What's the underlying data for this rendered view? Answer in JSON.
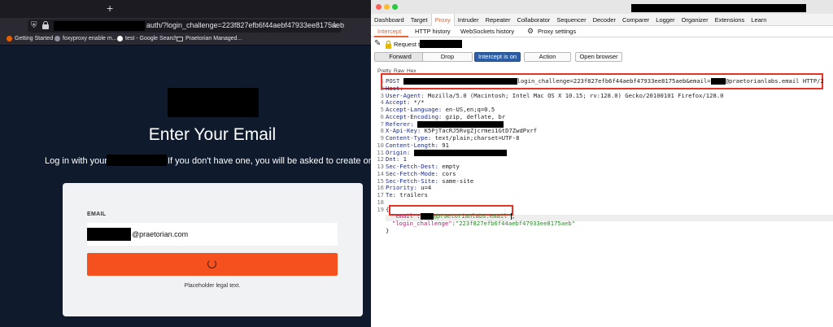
{
  "browser": {
    "new_tab_symbol": "+",
    "url_suffix": "auth/?login_challenge=223f827efb6f44aebf47933ee8175aeb",
    "bookmarks": [
      {
        "label": "Getting Started",
        "color": "#e66000"
      },
      {
        "label": "foxyproxy enable m...",
        "color": "#8f8fa0"
      },
      {
        "label": "test - Google Search",
        "color": "#ffffff"
      },
      {
        "label": "Praetorian Managed...",
        "color": "#c8c8c8"
      }
    ],
    "page": {
      "title": "Enter Your Email",
      "prompt_start": "Log in with your",
      "prompt_end": "If you don't have one, you will be asked to create one.",
      "email_label": "EMAIL",
      "email_domain": "@praetorian.com",
      "legal_text": "Placeholder legal text.",
      "button_color": "#f4511e"
    }
  },
  "burp": {
    "main_tabs": [
      "Dashboard",
      "Target",
      "Proxy",
      "Intruder",
      "Repeater",
      "Collaborator",
      "Sequencer",
      "Decoder",
      "Comparer",
      "Logger",
      "Organizer",
      "Extensions",
      "Learn"
    ],
    "active_main_tab": "Proxy",
    "sub_tabs": [
      "Intercept",
      "HTTP history",
      "WebSockets history"
    ],
    "proxy_settings_label": "Proxy settings",
    "request_label": "Request to",
    "buttons": {
      "forward": "Forward",
      "drop": "Drop",
      "intercept": "Intercept is on",
      "action": "Action",
      "open_browser": "Open browser"
    },
    "view_tabs": [
      "Pretty",
      "Raw",
      "Hex"
    ],
    "accent_color": "#e5623a",
    "highlight_color": "#e5332a",
    "request_lines": [
      {
        "n": "1",
        "key": "POST",
        "sep": " ",
        "val": "",
        "redact": 140,
        "after": "login_challenge=223f827efb6f44aebf47933ee8175aeb&email=",
        "redact2": 18,
        "tail": "@praetorianlabs.email HTTP/2"
      },
      {
        "n": "2",
        "key": "Host:",
        "val": ""
      },
      {
        "n": "3",
        "key": "User-Agent:",
        "val": " Mozilla/5.0 (Macintosh; Intel Mac OS X 10.15; rv:128.0) Gecko/20100101 Firefox/128.0"
      },
      {
        "n": "4",
        "key": "Accept:",
        "val": " */*"
      },
      {
        "n": "5",
        "key": "Accept-Language:",
        "val": " en-US,en;q=0.5"
      },
      {
        "n": "6",
        "key": "Accept-Encoding:",
        "val": " gzip, deflate, br"
      },
      {
        "n": "7",
        "key": "Referer:",
        "val": "",
        "redact": 106
      },
      {
        "n": "8",
        "key": "X-Api-Key:",
        "val": " K5PjTacRJ5RvgZjcrmei1GtD7ZwdPxrf"
      },
      {
        "n": "9",
        "key": "Content-Type:",
        "val": " text/plain;charset=UTF-8"
      },
      {
        "n": "10",
        "key": "Content-Length:",
        "val": " 91"
      },
      {
        "n": "11",
        "key": "Origin:",
        "val": "",
        "redact": 114
      },
      {
        "n": "12",
        "key": "Dnt:",
        "val": " 1"
      },
      {
        "n": "13",
        "key": "Sec-Fetch-Dest:",
        "val": " empty"
      },
      {
        "n": "14",
        "key": "Sec-Fetch-Mode:",
        "val": " cors"
      },
      {
        "n": "15",
        "key": "Sec-Fetch-Site:",
        "val": " same-site"
      },
      {
        "n": "16",
        "key": "Priority:",
        "val": " u=4"
      },
      {
        "n": "17",
        "key": "Te:",
        "val": " trailers"
      },
      {
        "n": "18",
        "key": "",
        "val": ""
      },
      {
        "n": "19",
        "key": "",
        "val": "{"
      }
    ],
    "json_body": {
      "email_key": "\"email\"",
      "email_domain": "@praetorianlabs.email\"",
      "challenge_key": "\"login_challenge\"",
      "challenge_val": "\"223f827efb6f44aebf47933ee8175aeb\"",
      "close": "}"
    }
  }
}
